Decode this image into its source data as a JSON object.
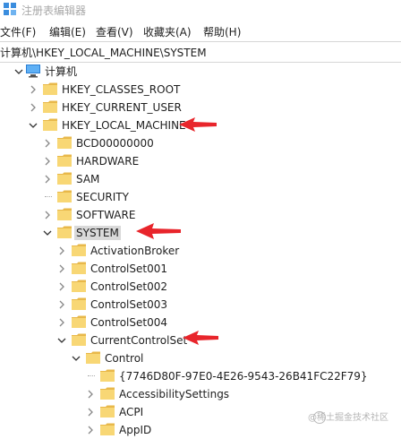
{
  "window": {
    "title": "注册表编辑器"
  },
  "menu": [
    "文件(F)",
    "编辑(E)",
    "查看(V)",
    "收藏夹(A)",
    "帮助(H)"
  ],
  "address": "计算机\\HKEY_LOCAL_MACHINE\\SYSTEM",
  "tree": [
    {
      "label": "计算机",
      "level": 0,
      "chevron": "down",
      "icon": "computer-icon"
    },
    {
      "label": "HKEY_CLASSES_ROOT",
      "level": 1,
      "chevron": "right",
      "icon": "folder-icon"
    },
    {
      "label": "HKEY_CURRENT_USER",
      "level": 1,
      "chevron": "right",
      "icon": "folder-icon"
    },
    {
      "label": "HKEY_LOCAL_MACHINE",
      "level": 1,
      "chevron": "down",
      "icon": "folder-icon",
      "annotated": true
    },
    {
      "label": "BCD00000000",
      "level": 2,
      "chevron": "right",
      "icon": "folder-icon"
    },
    {
      "label": "HARDWARE",
      "level": 2,
      "chevron": "right",
      "icon": "folder-icon"
    },
    {
      "label": "SAM",
      "level": 2,
      "chevron": "right",
      "icon": "folder-icon"
    },
    {
      "label": "SECURITY",
      "level": 2,
      "chevron": "none",
      "icon": "folder-icon"
    },
    {
      "label": "SOFTWARE",
      "level": 2,
      "chevron": "right",
      "icon": "folder-icon"
    },
    {
      "label": "SYSTEM",
      "level": 2,
      "chevron": "down",
      "icon": "folder-icon",
      "selected": true,
      "annotated": true
    },
    {
      "label": "ActivationBroker",
      "level": 3,
      "chevron": "right",
      "icon": "folder-icon"
    },
    {
      "label": "ControlSet001",
      "level": 3,
      "chevron": "right",
      "icon": "folder-icon"
    },
    {
      "label": "ControlSet002",
      "level": 3,
      "chevron": "right",
      "icon": "folder-icon"
    },
    {
      "label": "ControlSet003",
      "level": 3,
      "chevron": "right",
      "icon": "folder-icon"
    },
    {
      "label": "ControlSet004",
      "level": 3,
      "chevron": "right",
      "icon": "folder-icon"
    },
    {
      "label": "CurrentControlSet",
      "level": 3,
      "chevron": "down",
      "icon": "folder-icon",
      "annotated": true
    },
    {
      "label": "Control",
      "level": 4,
      "chevron": "down",
      "icon": "folder-icon"
    },
    {
      "label": "{7746D80F-97E0-4E26-9543-26B41FC22F79}",
      "level": 5,
      "chevron": "none",
      "icon": "folder-icon"
    },
    {
      "label": "AccessibilitySettings",
      "level": 5,
      "chevron": "right",
      "icon": "folder-icon"
    },
    {
      "label": "ACPI",
      "level": 5,
      "chevron": "right",
      "icon": "folder-icon"
    },
    {
      "label": "AppID",
      "level": 5,
      "chevron": "right",
      "icon": "folder-icon"
    }
  ],
  "watermark": "@稀土掘金技术社区",
  "colors": {
    "folder": "#f8d775",
    "folder_tab": "#e8b84a",
    "annotation_arrow": "#e8252b",
    "selection": "#d9d9d9"
  }
}
